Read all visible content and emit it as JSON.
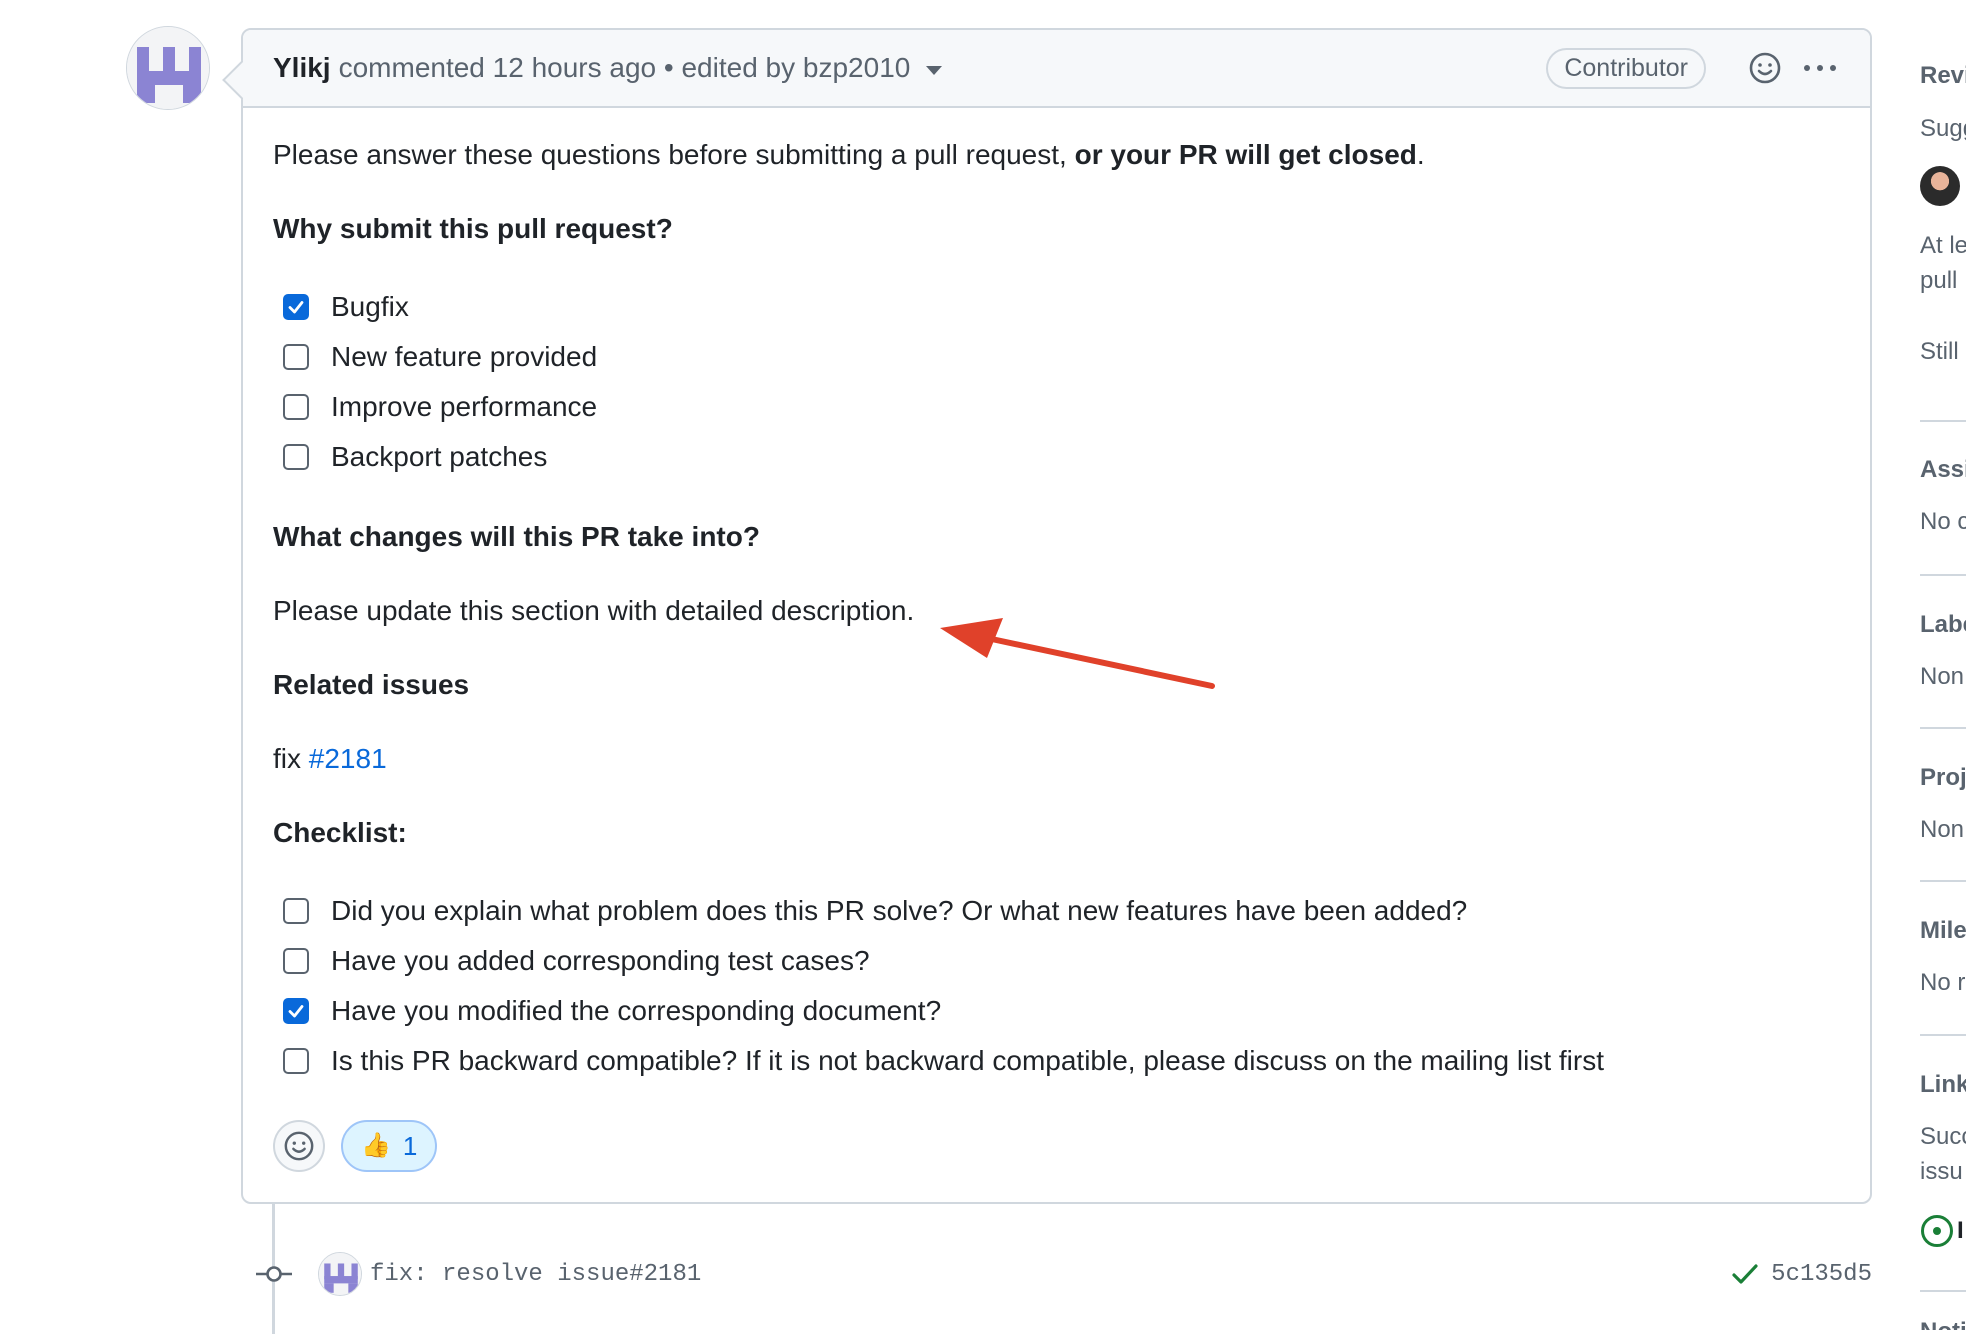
{
  "comment": {
    "author": "Ylikj",
    "meta": "commented 12 hours ago • edited by bzp2010",
    "role_badge": "Contributor",
    "intro_text": "Please answer these questions before submitting a pull request, ",
    "intro_bold": "or your PR will get closed",
    "intro_end": ".",
    "why_heading": "Why submit this pull request?",
    "why_items": [
      {
        "label": "Bugfix",
        "checked": true
      },
      {
        "label": "New feature provided",
        "checked": false
      },
      {
        "label": "Improve performance",
        "checked": false
      },
      {
        "label": "Backport patches",
        "checked": false
      }
    ],
    "changes_heading": "What changes will this PR take into?",
    "changes_text": "Please update this section with detailed description.",
    "related_heading": "Related issues",
    "related_prefix": "fix ",
    "related_link": "#2181",
    "checklist_heading": "Checklist:",
    "checklist_items": [
      {
        "label": "Did you explain what problem does this PR solve? Or what new features have been added?",
        "checked": false
      },
      {
        "label": "Have you added corresponding test cases?",
        "checked": false
      },
      {
        "label": "Have you modified the corresponding document?",
        "checked": true
      },
      {
        "label": "Is this PR backward compatible? If it is not backward compatible, please discuss on the mailing list first",
        "checked": false
      }
    ],
    "reaction": {
      "emoji": "👍",
      "count": "1"
    }
  },
  "commit": {
    "message": "fix: resolve issue#2181",
    "sha": "5c135d5",
    "status": "success"
  },
  "sidebar": {
    "reviewers_title": "Revi",
    "reviewers_suggest": "Sugg",
    "reviewers_note_1": "At le",
    "reviewers_note_2": "pull",
    "reviewers_still": "Still",
    "assignees_title": "Assi",
    "assignees_value": "No c",
    "labels_title": "Labe",
    "labels_value": "Non",
    "projects_title": "Proj",
    "projects_value": "Non",
    "milestone_title": "Mile",
    "milestone_value": "No r",
    "linked_title": "Link",
    "linked_text_1": "Succ",
    "linked_text_2": "issu",
    "linked_item": "I",
    "notifications_title": "Noti"
  },
  "colors": {
    "link": "#0969da",
    "checkbox_checked": "#0969da",
    "annotation_arrow": "#e0412a",
    "success": "#1a7f37"
  }
}
